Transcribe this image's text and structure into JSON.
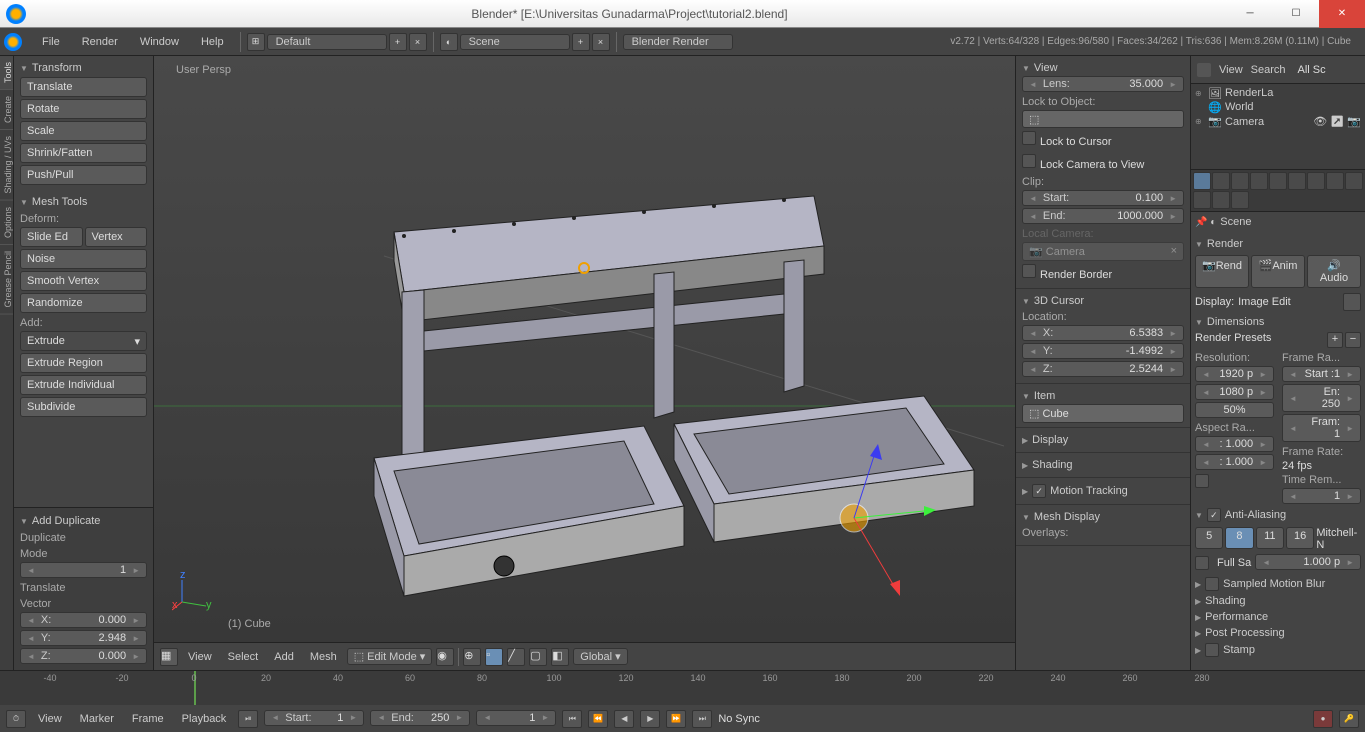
{
  "title": "Blender* [E:\\Universitas Gunadarma\\Project\\tutorial2.blend]",
  "menu": {
    "file": "File",
    "render": "Render",
    "window": "Window",
    "help": "Help",
    "layout": "Default",
    "scene": "Scene",
    "engine": "Blender Render"
  },
  "stats": "v2.72 | Verts:64/328 | Edges:96/580 | Faces:34/262 | Tris:636 | Mem:8.26M (0.11M) | Cube",
  "tabs": [
    "Tools",
    "Create",
    "Shading / UVs",
    "Options",
    "Grease Pencil"
  ],
  "transform": {
    "h": "Transform",
    "items": [
      "Translate",
      "Rotate",
      "Scale",
      "Shrink/Fatten",
      "Push/Pull"
    ]
  },
  "meshtools": {
    "h": "Mesh Tools",
    "deform": "Deform:",
    "slide": "Slide Ed",
    "vertex": "Vertex",
    "noise": "Noise",
    "smooth": "Smooth Vertex",
    "random": "Randomize",
    "add": "Add:",
    "extrude": "Extrude",
    "extrude_r": "Extrude Region",
    "extrude_i": "Extrude Individual",
    "subdivide": "Subdivide"
  },
  "operator": {
    "h": "Add Duplicate",
    "dup": "Duplicate",
    "mode": "Mode",
    "modeval": "1",
    "translate": "Translate",
    "vector": "Vector",
    "x": "X:",
    "xv": "0.000",
    "y": "Y:",
    "yv": "2.948",
    "z": "Z:",
    "zv": "0.000"
  },
  "vp": {
    "persp": "User Persp",
    "obj": "(1) Cube",
    "view": "View",
    "select": "Select",
    "add": "Add",
    "mesh": "Mesh",
    "mode": "Edit Mode",
    "orient": "Global"
  },
  "npanel": {
    "view": {
      "h": "View",
      "lens": "Lens:",
      "lensv": "35.000",
      "lockobj": "Lock to Object:",
      "lockcursor": "Lock to Cursor",
      "lockcam": "Lock Camera to View",
      "clip": "Clip:",
      "start": "Start:",
      "startv": "0.100",
      "end": "End:",
      "endv": "1000.000",
      "localcam": "Local Camera:",
      "camera": "Camera",
      "rborder": "Render Border"
    },
    "cursor": {
      "h": "3D Cursor",
      "loc": "Location:",
      "x": "X:",
      "xv": "6.5383",
      "y": "Y:",
      "yv": "-1.4992",
      "z": "Z:",
      "zv": "2.5244"
    },
    "item": {
      "h": "Item",
      "name": "Cube"
    },
    "display": "Display",
    "shading": "Shading",
    "motion": "Motion Tracking",
    "meshdisp": "Mesh Display",
    "overlays": "Overlays:"
  },
  "outliner": {
    "view": "View",
    "search": "Search",
    "allsc": "All Sc",
    "items": [
      "RenderLa",
      "World",
      "Camera"
    ]
  },
  "scene_name": "Scene",
  "render": {
    "h": "Render",
    "rend": "Rend",
    "anim": "Anim",
    "audio": "Audio",
    "display": "Display:",
    "displayv": "Image Edit"
  },
  "dims": {
    "h": "Dimensions",
    "presets": "Render Presets",
    "res": "Resolution:",
    "framerange": "Frame Ra...",
    "x": "1920 p",
    "y": "1080 p",
    "pct": "50%",
    "start": "Start :1",
    "end": "En: 250",
    "fram": "Fram: 1",
    "aspect": "Aspect Ra...",
    "framerate": "Frame Rate:",
    "ar1": ": 1.000",
    "ar2": ": 1.000",
    "fps": "24 fps",
    "timerem": "Time Rem...",
    "tr1": "1"
  },
  "aa": {
    "h": "Anti-Aliasing",
    "5": "5",
    "8": "8",
    "11": "11",
    "16": "16",
    "filter": "Mitchell-N",
    "fullsa": "Full Sa",
    "size": "1.000 p"
  },
  "collapsed": [
    "Sampled Motion Blur",
    "Shading",
    "Performance",
    "Post Processing",
    "Stamp"
  ],
  "timeline": {
    "ticks": [
      "-40",
      "-20",
      "0",
      "20",
      "40",
      "60",
      "80",
      "100",
      "120",
      "140",
      "160",
      "180",
      "200",
      "220",
      "240",
      "260",
      "280"
    ],
    "view": "View",
    "marker": "Marker",
    "frame": "Frame",
    "playback": "Playback",
    "start": "Start:",
    "startv": "1",
    "end": "End:",
    "endv": "250",
    "cur": "1",
    "sync": "No Sync"
  }
}
